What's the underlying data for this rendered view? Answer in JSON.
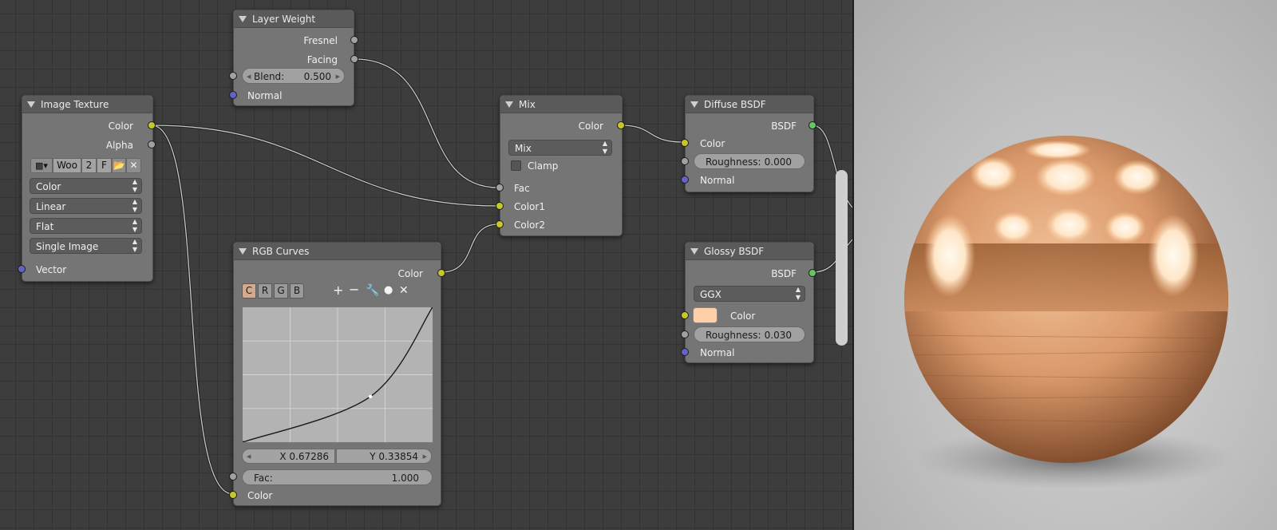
{
  "image_texture": {
    "title": "Image Texture",
    "outputs": {
      "color": "Color",
      "alpha": "Alpha"
    },
    "image_name": "Woo",
    "users": "2",
    "fake": "F",
    "color_space": "Color",
    "interpolation": "Linear",
    "projection": "Flat",
    "source": "Single Image",
    "input_vector": "Vector"
  },
  "layer_weight": {
    "title": "Layer Weight",
    "outputs": {
      "fresnel": "Fresnel",
      "facing": "Facing"
    },
    "blend_label": "Blend:",
    "blend_value": "0.500",
    "input_normal": "Normal"
  },
  "mix": {
    "title": "Mix",
    "output_color": "Color",
    "blend_type": "Mix",
    "clamp_label": "Clamp",
    "clamp_checked": false,
    "inputs": {
      "fac": "Fac",
      "color1": "Color1",
      "color2": "Color2"
    }
  },
  "rgb_curves": {
    "title": "RGB Curves",
    "output_color": "Color",
    "channels": [
      "C",
      "R",
      "G",
      "B"
    ],
    "active_channel": "C",
    "tool_icons": [
      "plus-icon",
      "minus-icon",
      "wrench-icon",
      "dot-icon",
      "close-icon"
    ],
    "x_field": "X 0.67286",
    "y_field": "Y 0.33854",
    "fac_label": "Fac:",
    "fac_value": "1.000",
    "input_color": "Color",
    "curve_points": [
      [
        0,
        0
      ],
      [
        0.67286,
        0.33854
      ],
      [
        1,
        1
      ]
    ]
  },
  "diffuse_bsdf": {
    "title": "Diffuse BSDF",
    "output": "BSDF",
    "input_color": "Color",
    "roughness_label": "Roughness:",
    "roughness_value": "0.000",
    "input_normal": "Normal"
  },
  "glossy_bsdf": {
    "title": "Glossy BSDF",
    "output": "BSDF",
    "distribution": "GGX",
    "input_color": "Color",
    "color_swatch": "#ffd0a8",
    "roughness_label": "Roughness:",
    "roughness_value": "0.030",
    "input_normal": "Normal"
  },
  "colors": {
    "socket_color": "#c7c729",
    "socket_float": "#a1a1a1",
    "socket_vector": "#6363c7",
    "socket_shader": "#63c763",
    "active_channel": "#d1aa8f"
  }
}
